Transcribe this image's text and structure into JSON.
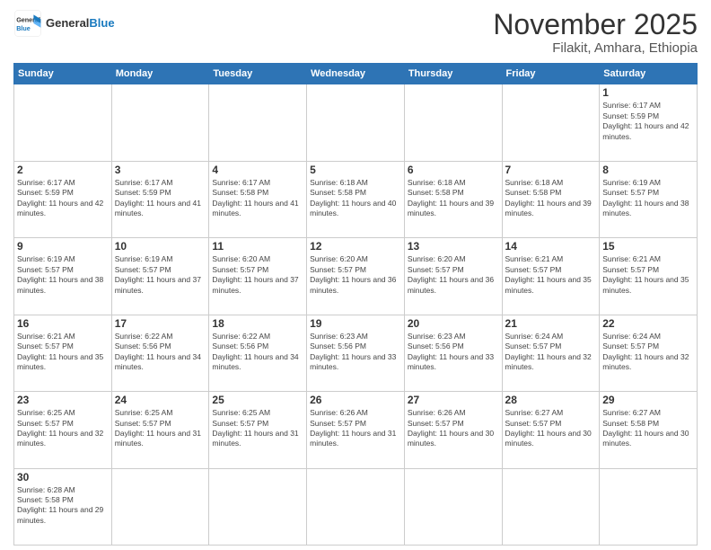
{
  "header": {
    "logo_general": "General",
    "logo_blue": "Blue",
    "main_title": "November 2025",
    "subtitle": "Filakit, Amhara, Ethiopia"
  },
  "weekdays": [
    "Sunday",
    "Monday",
    "Tuesday",
    "Wednesday",
    "Thursday",
    "Friday",
    "Saturday"
  ],
  "weeks": [
    [
      {
        "day": "",
        "sunrise": "",
        "sunset": "",
        "daylight": "",
        "empty": true
      },
      {
        "day": "",
        "sunrise": "",
        "sunset": "",
        "daylight": "",
        "empty": true
      },
      {
        "day": "",
        "sunrise": "",
        "sunset": "",
        "daylight": "",
        "empty": true
      },
      {
        "day": "",
        "sunrise": "",
        "sunset": "",
        "daylight": "",
        "empty": true
      },
      {
        "day": "",
        "sunrise": "",
        "sunset": "",
        "daylight": "",
        "empty": true
      },
      {
        "day": "",
        "sunrise": "",
        "sunset": "",
        "daylight": "",
        "empty": true
      },
      {
        "day": "1",
        "sunrise": "Sunrise: 6:17 AM",
        "sunset": "Sunset: 5:59 PM",
        "daylight": "Daylight: 11 hours and 42 minutes.",
        "empty": false
      }
    ],
    [
      {
        "day": "2",
        "sunrise": "Sunrise: 6:17 AM",
        "sunset": "Sunset: 5:59 PM",
        "daylight": "Daylight: 11 hours and 42 minutes.",
        "empty": false
      },
      {
        "day": "3",
        "sunrise": "Sunrise: 6:17 AM",
        "sunset": "Sunset: 5:59 PM",
        "daylight": "Daylight: 11 hours and 41 minutes.",
        "empty": false
      },
      {
        "day": "4",
        "sunrise": "Sunrise: 6:17 AM",
        "sunset": "Sunset: 5:58 PM",
        "daylight": "Daylight: 11 hours and 41 minutes.",
        "empty": false
      },
      {
        "day": "5",
        "sunrise": "Sunrise: 6:18 AM",
        "sunset": "Sunset: 5:58 PM",
        "daylight": "Daylight: 11 hours and 40 minutes.",
        "empty": false
      },
      {
        "day": "6",
        "sunrise": "Sunrise: 6:18 AM",
        "sunset": "Sunset: 5:58 PM",
        "daylight": "Daylight: 11 hours and 39 minutes.",
        "empty": false
      },
      {
        "day": "7",
        "sunrise": "Sunrise: 6:18 AM",
        "sunset": "Sunset: 5:58 PM",
        "daylight": "Daylight: 11 hours and 39 minutes.",
        "empty": false
      },
      {
        "day": "8",
        "sunrise": "Sunrise: 6:19 AM",
        "sunset": "Sunset: 5:57 PM",
        "daylight": "Daylight: 11 hours and 38 minutes.",
        "empty": false
      }
    ],
    [
      {
        "day": "9",
        "sunrise": "Sunrise: 6:19 AM",
        "sunset": "Sunset: 5:57 PM",
        "daylight": "Daylight: 11 hours and 38 minutes.",
        "empty": false
      },
      {
        "day": "10",
        "sunrise": "Sunrise: 6:19 AM",
        "sunset": "Sunset: 5:57 PM",
        "daylight": "Daylight: 11 hours and 37 minutes.",
        "empty": false
      },
      {
        "day": "11",
        "sunrise": "Sunrise: 6:20 AM",
        "sunset": "Sunset: 5:57 PM",
        "daylight": "Daylight: 11 hours and 37 minutes.",
        "empty": false
      },
      {
        "day": "12",
        "sunrise": "Sunrise: 6:20 AM",
        "sunset": "Sunset: 5:57 PM",
        "daylight": "Daylight: 11 hours and 36 minutes.",
        "empty": false
      },
      {
        "day": "13",
        "sunrise": "Sunrise: 6:20 AM",
        "sunset": "Sunset: 5:57 PM",
        "daylight": "Daylight: 11 hours and 36 minutes.",
        "empty": false
      },
      {
        "day": "14",
        "sunrise": "Sunrise: 6:21 AM",
        "sunset": "Sunset: 5:57 PM",
        "daylight": "Daylight: 11 hours and 35 minutes.",
        "empty": false
      },
      {
        "day": "15",
        "sunrise": "Sunrise: 6:21 AM",
        "sunset": "Sunset: 5:57 PM",
        "daylight": "Daylight: 11 hours and 35 minutes.",
        "empty": false
      }
    ],
    [
      {
        "day": "16",
        "sunrise": "Sunrise: 6:21 AM",
        "sunset": "Sunset: 5:57 PM",
        "daylight": "Daylight: 11 hours and 35 minutes.",
        "empty": false
      },
      {
        "day": "17",
        "sunrise": "Sunrise: 6:22 AM",
        "sunset": "Sunset: 5:56 PM",
        "daylight": "Daylight: 11 hours and 34 minutes.",
        "empty": false
      },
      {
        "day": "18",
        "sunrise": "Sunrise: 6:22 AM",
        "sunset": "Sunset: 5:56 PM",
        "daylight": "Daylight: 11 hours and 34 minutes.",
        "empty": false
      },
      {
        "day": "19",
        "sunrise": "Sunrise: 6:23 AM",
        "sunset": "Sunset: 5:56 PM",
        "daylight": "Daylight: 11 hours and 33 minutes.",
        "empty": false
      },
      {
        "day": "20",
        "sunrise": "Sunrise: 6:23 AM",
        "sunset": "Sunset: 5:56 PM",
        "daylight": "Daylight: 11 hours and 33 minutes.",
        "empty": false
      },
      {
        "day": "21",
        "sunrise": "Sunrise: 6:24 AM",
        "sunset": "Sunset: 5:57 PM",
        "daylight": "Daylight: 11 hours and 32 minutes.",
        "empty": false
      },
      {
        "day": "22",
        "sunrise": "Sunrise: 6:24 AM",
        "sunset": "Sunset: 5:57 PM",
        "daylight": "Daylight: 11 hours and 32 minutes.",
        "empty": false
      }
    ],
    [
      {
        "day": "23",
        "sunrise": "Sunrise: 6:25 AM",
        "sunset": "Sunset: 5:57 PM",
        "daylight": "Daylight: 11 hours and 32 minutes.",
        "empty": false
      },
      {
        "day": "24",
        "sunrise": "Sunrise: 6:25 AM",
        "sunset": "Sunset: 5:57 PM",
        "daylight": "Daylight: 11 hours and 31 minutes.",
        "empty": false
      },
      {
        "day": "25",
        "sunrise": "Sunrise: 6:25 AM",
        "sunset": "Sunset: 5:57 PM",
        "daylight": "Daylight: 11 hours and 31 minutes.",
        "empty": false
      },
      {
        "day": "26",
        "sunrise": "Sunrise: 6:26 AM",
        "sunset": "Sunset: 5:57 PM",
        "daylight": "Daylight: 11 hours and 31 minutes.",
        "empty": false
      },
      {
        "day": "27",
        "sunrise": "Sunrise: 6:26 AM",
        "sunset": "Sunset: 5:57 PM",
        "daylight": "Daylight: 11 hours and 30 minutes.",
        "empty": false
      },
      {
        "day": "28",
        "sunrise": "Sunrise: 6:27 AM",
        "sunset": "Sunset: 5:57 PM",
        "daylight": "Daylight: 11 hours and 30 minutes.",
        "empty": false
      },
      {
        "day": "29",
        "sunrise": "Sunrise: 6:27 AM",
        "sunset": "Sunset: 5:58 PM",
        "daylight": "Daylight: 11 hours and 30 minutes.",
        "empty": false
      }
    ],
    [
      {
        "day": "30",
        "sunrise": "Sunrise: 6:28 AM",
        "sunset": "Sunset: 5:58 PM",
        "daylight": "Daylight: 11 hours and 29 minutes.",
        "empty": false
      },
      {
        "day": "",
        "empty": true
      },
      {
        "day": "",
        "empty": true
      },
      {
        "day": "",
        "empty": true
      },
      {
        "day": "",
        "empty": true
      },
      {
        "day": "",
        "empty": true
      },
      {
        "day": "",
        "empty": true
      }
    ]
  ]
}
